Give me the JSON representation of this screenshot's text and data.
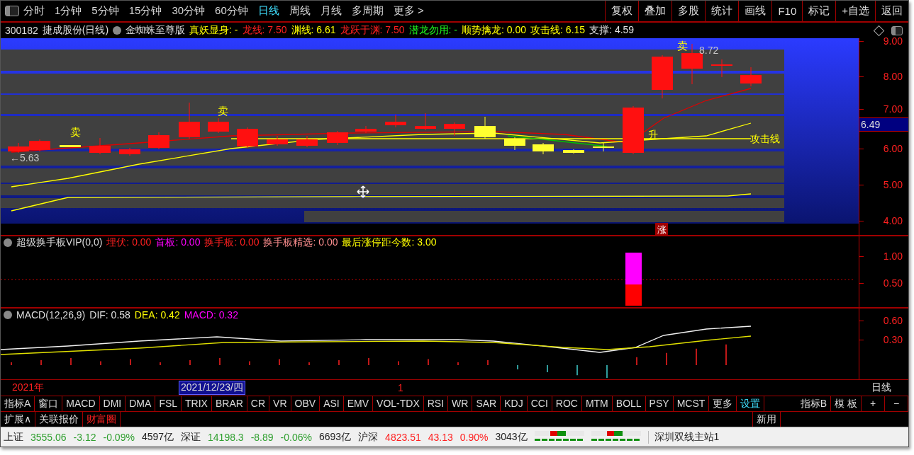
{
  "toolbar": {
    "periods": [
      {
        "label": "分时",
        "selected": false
      },
      {
        "label": "1分钟",
        "selected": false
      },
      {
        "label": "5分钟",
        "selected": false
      },
      {
        "label": "15分钟",
        "selected": false
      },
      {
        "label": "30分钟",
        "selected": false
      },
      {
        "label": "60分钟",
        "selected": false
      },
      {
        "label": "日线",
        "selected": true
      },
      {
        "label": "周线",
        "selected": false
      },
      {
        "label": "月线",
        "selected": false
      },
      {
        "label": "多周期",
        "selected": false
      },
      {
        "label": "更多 >",
        "selected": false
      }
    ],
    "buttons": [
      "复权",
      "叠加",
      "多股",
      "统计",
      "画线",
      "F10",
      "标记",
      "+自选",
      "返回"
    ]
  },
  "title_bar": {
    "code": "300182",
    "name": "捷成股份(日线)",
    "indicator": "金蜘蛛至尊版",
    "values": [
      {
        "label": "真妖显身:",
        "value": "-",
        "color": "#ffff00"
      },
      {
        "label": "龙线:",
        "value": "7.50",
        "color": "#ff2020"
      },
      {
        "label": "渊线:",
        "value": "6.61",
        "color": "#ffff00"
      },
      {
        "label": "龙跃于渊:",
        "value": "7.50",
        "color": "#ff2020"
      },
      {
        "label": "潜龙勿用:",
        "value": "-",
        "color": "#20ff20"
      },
      {
        "label": "顺势擒龙:",
        "value": "0.00",
        "color": "#ffff00"
      },
      {
        "label": "攻击线:",
        "value": "6.15",
        "color": "#ffff00"
      },
      {
        "label": "支撑:",
        "value": "4.59",
        "color": "#e0e0e0"
      }
    ]
  },
  "price_chart": {
    "axis_labels": [
      "9.00",
      "8.00",
      "7.00",
      "6.00",
      "5.00",
      "4.00"
    ],
    "current_price": "6.49",
    "markers": [
      {
        "kind": "sell",
        "text": "卖"
      },
      {
        "kind": "sell",
        "text": "卖"
      },
      {
        "kind": "price",
        "text": "←5.63"
      },
      {
        "kind": "sell",
        "text": "卖"
      },
      {
        "kind": "price",
        "text": "8.72"
      },
      {
        "kind": "signal",
        "text": "升"
      },
      {
        "kind": "line_label",
        "text": "攻击线"
      },
      {
        "kind": "limit_up",
        "text": "涨"
      }
    ]
  },
  "turnover_panel": {
    "title": "超级换手板VIP(0,0)",
    "values": [
      {
        "label": "埋伏:",
        "value": "0.00",
        "color": "#ff2020"
      },
      {
        "label": "首板:",
        "value": "0.00",
        "color": "#ff00ff"
      },
      {
        "label": "换手板:",
        "value": "0.00",
        "color": "#ff2020"
      },
      {
        "label": "换手板精选:",
        "value": "0.00",
        "color": "#ff9090"
      },
      {
        "label": "最后涨停距今数:",
        "value": "3.00",
        "color": "#ffff00"
      }
    ],
    "axis_labels": [
      "1.00",
      "0.50"
    ]
  },
  "macd_panel": {
    "title": "MACD(12,26,9)",
    "values": [
      {
        "label": "DIF:",
        "value": "0.58",
        "color": "#e0e0e0"
      },
      {
        "label": "DEA:",
        "value": "0.42",
        "color": "#ffff00"
      },
      {
        "label": "MACD:",
        "value": "0.32",
        "color": "#ff00ff"
      }
    ],
    "axis_labels": [
      "0.60",
      "0.30"
    ]
  },
  "date_axis": {
    "year": "2021年",
    "cursor_date": "2021/12/23/四",
    "month": "1",
    "period": "日线"
  },
  "indicator_tabs": [
    {
      "label": "指标A",
      "selected": false
    },
    {
      "label": "窗口",
      "selected": false
    },
    {
      "label": "MACD",
      "selected": false
    },
    {
      "label": "DMI",
      "selected": false
    },
    {
      "label": "DMA",
      "selected": false
    },
    {
      "label": "FSL",
      "selected": false
    },
    {
      "label": "TRIX",
      "selected": false
    },
    {
      "label": "BRAR",
      "selected": false
    },
    {
      "label": "CR",
      "selected": false
    },
    {
      "label": "VR",
      "selected": false
    },
    {
      "label": "OBV",
      "selected": false
    },
    {
      "label": "ASI",
      "selected": false
    },
    {
      "label": "EMV",
      "selected": false
    },
    {
      "label": "VOL-TDX",
      "selected": false
    },
    {
      "label": "RSI",
      "selected": false
    },
    {
      "label": "WR",
      "selected": false
    },
    {
      "label": "SAR",
      "selected": false
    },
    {
      "label": "KDJ",
      "selected": false
    },
    {
      "label": "CCI",
      "selected": false
    },
    {
      "label": "ROC",
      "selected": false
    },
    {
      "label": "MTM",
      "selected": false
    },
    {
      "label": "BOLL",
      "selected": false
    },
    {
      "label": "PSY",
      "selected": false
    },
    {
      "label": "MCST",
      "selected": false
    },
    {
      "label": "更多",
      "selected": false
    },
    {
      "label": "设置",
      "selected": true
    }
  ],
  "indicator_tools": [
    "指标B",
    "模 板",
    "+",
    "−"
  ],
  "bottom_tabs": [
    {
      "label": "扩展∧",
      "selected": false
    },
    {
      "label": "关联报价",
      "selected": false
    },
    {
      "label": "财富圈",
      "selected": true
    }
  ],
  "bottom_right": "新用",
  "status_bar": {
    "indices": [
      {
        "name": "上证",
        "value": "3555.06",
        "change": "-3.12",
        "percent": "-0.09%",
        "amount": "4597亿",
        "color": "#30a030"
      },
      {
        "name": "深证",
        "value": "14198.3",
        "change": "-8.89",
        "percent": "-0.06%",
        "amount": "6693亿",
        "color": "#30a030"
      },
      {
        "name": "沪深",
        "value": "4823.51",
        "change": "43.13",
        "percent": "0.90%",
        "amount": "3043亿",
        "color": "#ff2020"
      }
    ],
    "server": "深圳双线主站1"
  }
}
